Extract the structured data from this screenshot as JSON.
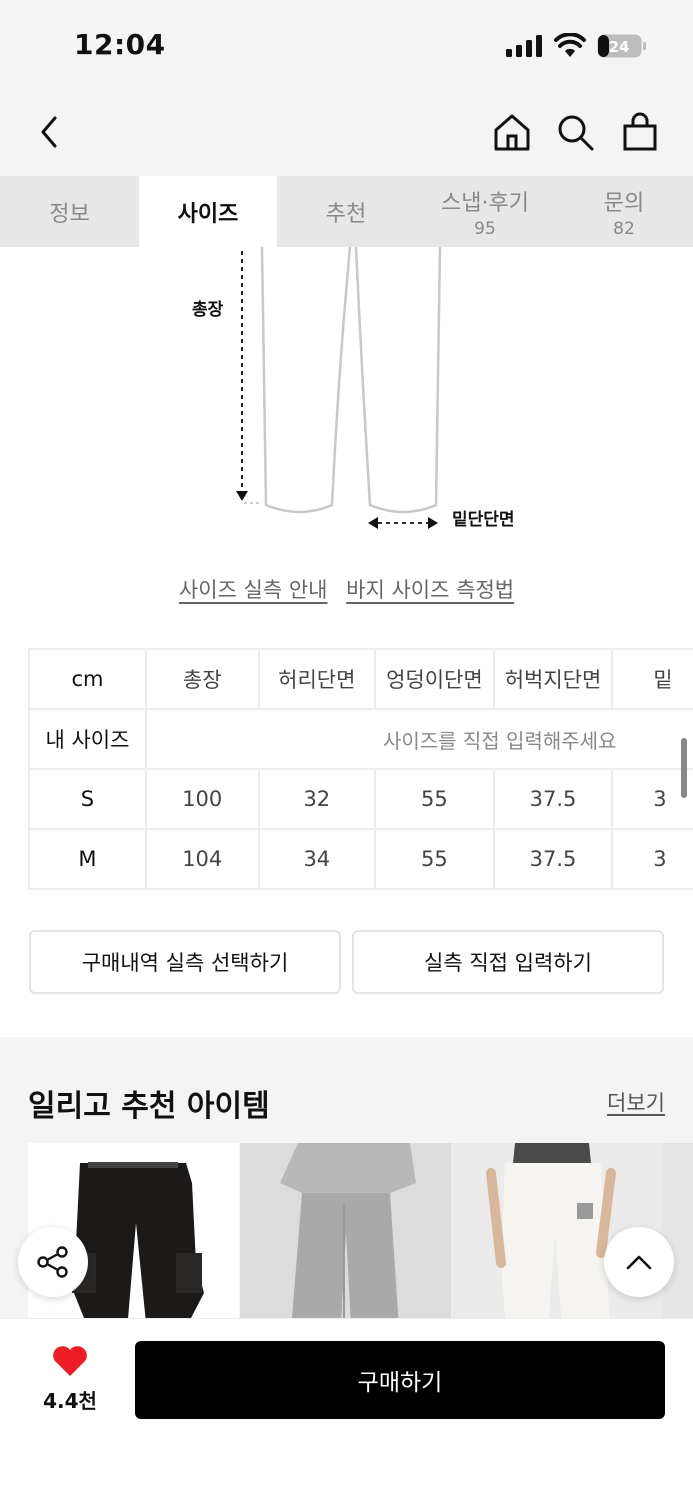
{
  "status_bar": {
    "time": "12:04",
    "battery": "24"
  },
  "tabs": [
    {
      "label": "정보",
      "count": ""
    },
    {
      "label": "사이즈",
      "count": ""
    },
    {
      "label": "추천",
      "count": ""
    },
    {
      "label": "스냅·후기",
      "count": "95"
    },
    {
      "label": "문의",
      "count": "82"
    }
  ],
  "active_tab": "사이즈",
  "diagram": {
    "total_length_label": "총장",
    "hem_label": "밑단단면"
  },
  "guide_links": {
    "size_guide": "사이즈 실측 안내",
    "pants_measure": "바지 사이즈 측정법"
  },
  "size_table": {
    "headers": [
      "cm",
      "총장",
      "허리단면",
      "엉덩이단면",
      "허벅지단면",
      "밑"
    ],
    "my_size_label": "내 사이즈",
    "my_size_placeholder": "사이즈를 직접 입력해주세요",
    "rows": [
      {
        "size": "S",
        "values": [
          "100",
          "32",
          "55",
          "37.5",
          "3"
        ]
      },
      {
        "size": "M",
        "values": [
          "104",
          "34",
          "55",
          "37.5",
          "3"
        ]
      }
    ]
  },
  "buttons": {
    "purchase_history": "구매내역 실측 선택하기",
    "manual_input": "실측 직접 입력하기"
  },
  "recommend": {
    "title": "일리고 추천 아이템",
    "more": "더보기"
  },
  "bottom": {
    "like_count": "4.4천",
    "buy_label": "구매하기"
  },
  "colors": {
    "heart": "#ee1c25",
    "buy_button": "#000000",
    "tab_bg": "#e7e7e7"
  }
}
